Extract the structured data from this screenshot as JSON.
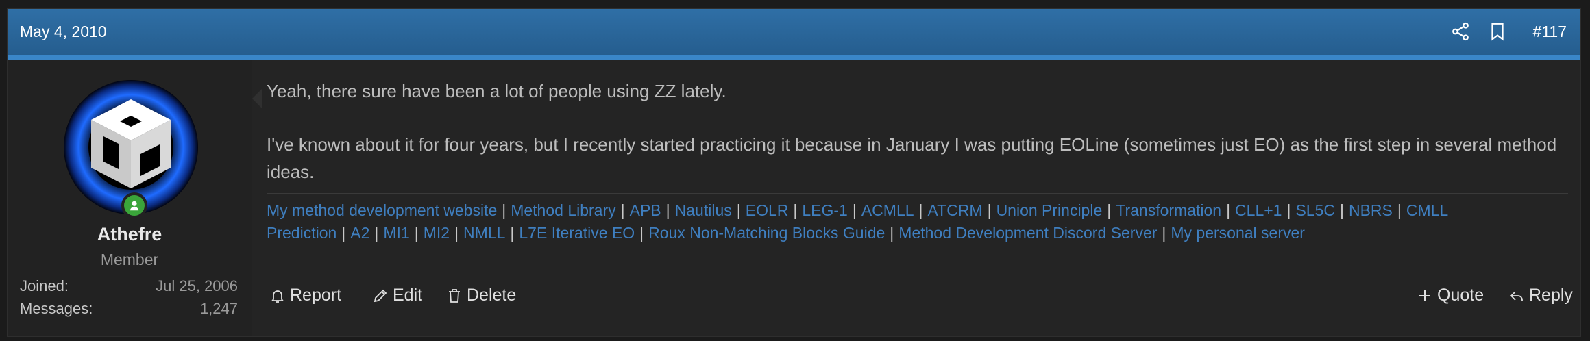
{
  "post": {
    "date": "May 4, 2010",
    "number": "#117"
  },
  "user": {
    "name": "Athefre",
    "title": "Member",
    "stats": [
      {
        "label": "Joined:",
        "value": "Jul 25, 2006"
      },
      {
        "label": "Messages:",
        "value": "1,247"
      }
    ]
  },
  "message": {
    "paragraphs": [
      "Yeah, there sure have been a lot of people using ZZ lately.",
      "I've known about it for four years, but I recently started practicing it because in January I was putting EOLine (sometimes just EO) as the first step in several method ideas."
    ]
  },
  "signature": {
    "separator": "|",
    "links": [
      "My method development website",
      "Method Library",
      "APB",
      "Nautilus",
      "EOLR",
      "LEG-1",
      "ACMLL",
      "ATCRM",
      "Union Principle",
      "Transformation",
      "CLL+1",
      "SL5C",
      "NBRS",
      "CMLL Prediction",
      "A2",
      "MI1",
      "MI2",
      "NMLL",
      "L7E Iterative EO",
      "Roux Non-Matching Blocks Guide",
      "Method Development Discord Server",
      "My personal server"
    ]
  },
  "actions": {
    "report": "Report",
    "edit": "Edit",
    "delete": "Delete",
    "quote": "Quote",
    "reply": "Reply"
  },
  "icons": {
    "share": "share-icon",
    "bookmark": "bookmark-icon",
    "report": "bell-icon",
    "edit": "pencil-icon",
    "delete": "trash-icon",
    "quote": "plus-icon",
    "reply": "reply-icon",
    "online": "online-status-icon"
  },
  "colors": {
    "header": "#2a679c",
    "header_border": "#3a86c8",
    "link": "#3f7fc0",
    "online": "#3aa53a",
    "avatar_glow": "#1f6bff"
  }
}
